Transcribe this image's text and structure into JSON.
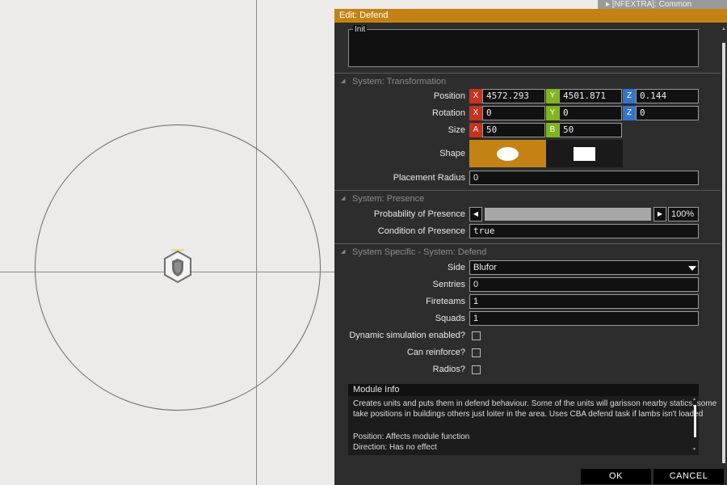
{
  "top_hint": "▸  [NFEXTRA]: Common",
  "dialog": {
    "title": "Edit: Defend",
    "init_label": "Init",
    "init_value": ""
  },
  "transformation": {
    "header": "System: Transformation",
    "position": {
      "label": "Position",
      "x": "4572.293",
      "y": "4501.871",
      "z": "0.144"
    },
    "rotation": {
      "label": "Rotation",
      "x": "0",
      "y": "0",
      "z": "0"
    },
    "size": {
      "label": "Size",
      "a": "50",
      "b": "50"
    },
    "shape": {
      "label": "Shape",
      "selected": "ellipse"
    },
    "placement_radius": {
      "label": "Placement Radius",
      "value": "0"
    },
    "axis_labels": {
      "x": "X",
      "y": "Y",
      "z": "Z",
      "a": "A",
      "b": "B"
    }
  },
  "presence": {
    "header": "System: Presence",
    "probability": {
      "label": "Probability of Presence",
      "value_text": "100%",
      "fraction": 1.0
    },
    "condition": {
      "label": "Condition of Presence",
      "value": "true"
    }
  },
  "specific": {
    "header": "System Specific - System: Defend",
    "side": {
      "label": "Side",
      "value": "Blufor"
    },
    "sentries": {
      "label": "Sentries",
      "value": "0"
    },
    "fireteams": {
      "label": "Fireteams",
      "value": "1"
    },
    "squads": {
      "label": "Squads",
      "value": "1"
    },
    "dynamic_sim": {
      "label": "Dynamic simulation enabled?",
      "checked": false
    },
    "can_reinforce": {
      "label": "Can reinforce?",
      "checked": false
    },
    "radios": {
      "label": "Radios?",
      "checked": false
    }
  },
  "module_info": {
    "title": "Module Info",
    "line1": "Creates units and puts them in defend behaviour. Some of the units will garisson nearby statics, some",
    "line2": "take positions in buildings others just loiter in the area. Uses CBA defend task if lambs isn't loaded",
    "line3": "Position: Affects module function",
    "line4": "Direction: Has no effect"
  },
  "footer": {
    "ok": "OK",
    "cancel": "CANCEL"
  },
  "colors": {
    "accent": "#c48214",
    "axis_x": "#c8321e",
    "axis_y": "#7fb51e",
    "axis_z": "#3575c8"
  }
}
